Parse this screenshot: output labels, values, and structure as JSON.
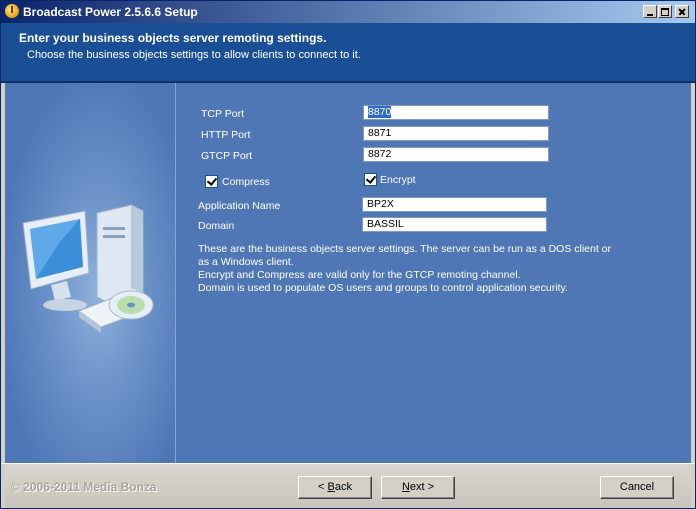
{
  "window": {
    "title": "Broadcast Power 2.5.6.6 Setup"
  },
  "header": {
    "title": "Enter your business objects server remoting settings.",
    "subtitle": "Choose the business objects settings to allow clients to connect to it."
  },
  "form": {
    "tcp_port": {
      "label": "TCP Port",
      "value": "8870"
    },
    "http_port": {
      "label": "HTTP Port",
      "value": "8871"
    },
    "gtcp_port": {
      "label": "GTCP Port",
      "value": "8872"
    },
    "compress": {
      "label": "Compress",
      "checked": true
    },
    "encrypt": {
      "label": "Encrypt",
      "checked": true
    },
    "application_name": {
      "label": "Application Name",
      "value": "BP2X"
    },
    "domain": {
      "label": "Domain",
      "value": "BASSIL"
    }
  },
  "info": {
    "line1": "These are the business objects server settings. The server can be run as a DOS client or",
    "line2": "as a Windows client.",
    "line3": "Encrypt and Compress are valid only for the GTCP remoting channel.",
    "line4": "Domain is used to populate OS users and groups to control application security."
  },
  "footer": {
    "copyright": "© 2006-2011 Media Bonza",
    "back_prefix": "< ",
    "back_accel": "B",
    "back_rest": "ack",
    "next_accel": "N",
    "next_rest": "ext >",
    "cancel_label": "Cancel"
  },
  "icons": {
    "app": "broadcast-power-icon",
    "illustration": "computer-illustration"
  },
  "colors": {
    "title_bar": "#0a246a",
    "header": "#1b4f95",
    "body": "#4f77b6",
    "selection": "#316ac5"
  }
}
